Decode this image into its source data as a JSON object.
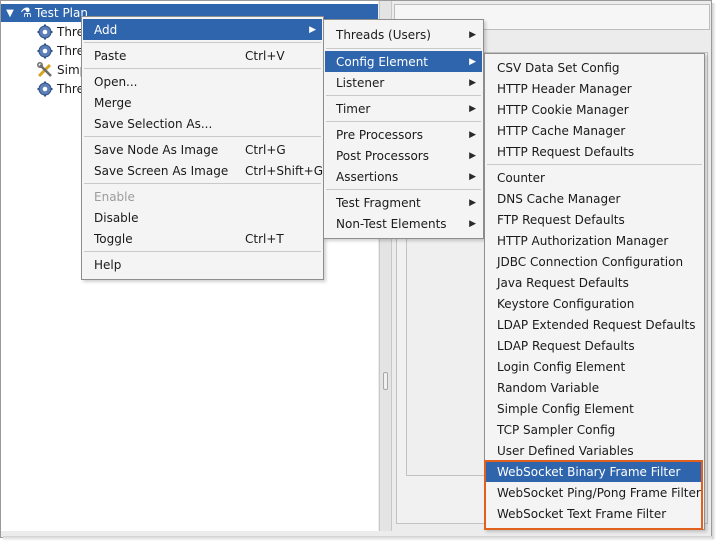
{
  "tree": {
    "root_label": "Test Plan",
    "items": [
      {
        "label": "Thre",
        "icon": "gear-icon"
      },
      {
        "label": "Thre",
        "icon": "gear-icon"
      },
      {
        "label": "Simp",
        "icon": "tools-icon"
      },
      {
        "label": "Thre",
        "icon": "gear-icon"
      }
    ]
  },
  "context_menu": {
    "add": "Add",
    "paste": "Paste",
    "paste_shortcut": "Ctrl+V",
    "open": "Open...",
    "merge": "Merge",
    "save_selection": "Save Selection As...",
    "save_node_image": "Save Node As Image",
    "save_node_image_shortcut": "Ctrl+G",
    "save_screen_image": "Save Screen As Image",
    "save_screen_image_shortcut": "Ctrl+Shift+G",
    "enable": "Enable",
    "disable": "Disable",
    "toggle": "Toggle",
    "toggle_shortcut": "Ctrl+T",
    "help": "Help"
  },
  "add_menu": {
    "threads": "Threads (Users)",
    "config_element": "Config Element",
    "listener": "Listener",
    "timer": "Timer",
    "pre_processors": "Pre Processors",
    "post_processors": "Post Processors",
    "assertions": "Assertions",
    "test_fragment": "Test Fragment",
    "non_test_elements": "Non-Test Elements"
  },
  "config_menu": {
    "items": [
      "CSV Data Set Config",
      "HTTP Header Manager",
      "HTTP Cookie Manager",
      "HTTP Cache Manager",
      "HTTP Request Defaults",
      "Counter",
      "DNS Cache Manager",
      "FTP Request Defaults",
      "HTTP Authorization Manager",
      "JDBC Connection Configuration",
      "Java Request Defaults",
      "Keystore Configuration",
      "LDAP Extended Request Defaults",
      "LDAP Request Defaults",
      "Login Config Element",
      "Random Variable",
      "Simple Config Element",
      "TCP Sampler Config",
      "User Defined Variables",
      "WebSocket Binary Frame Filter",
      "WebSocket Ping/Pong Frame Filter",
      "WebSocket Text Frame Filter"
    ]
  },
  "colors": {
    "selection": "#2f65ad",
    "highlight_box": "#e0601d",
    "menu_bg": "#f4f4f4"
  }
}
